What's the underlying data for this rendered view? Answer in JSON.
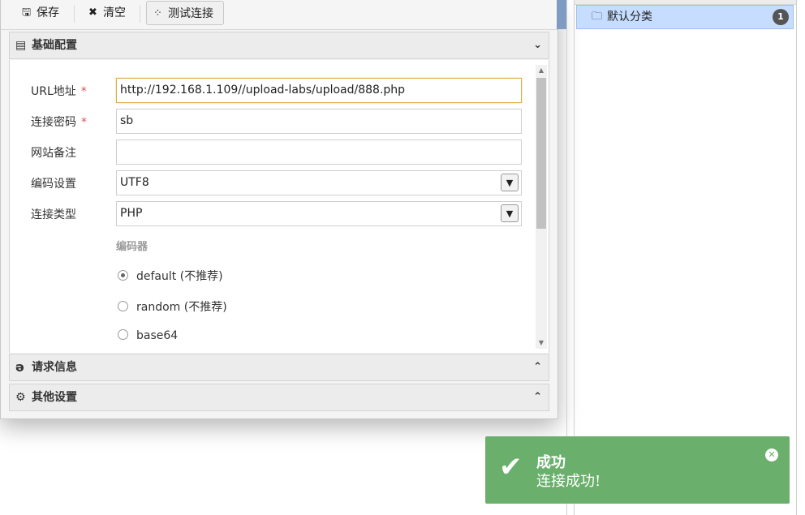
{
  "toolbar": {
    "save_label": "保存",
    "clear_label": "清空",
    "test_label": "测试连接",
    "save_icon": "floppy-icon",
    "clear_icon": "x-icon",
    "test_icon": "spinner-icon"
  },
  "panels": {
    "basic": {
      "title": "基础配置",
      "icon": "file-icon",
      "state": "expanded"
    },
    "request": {
      "title": "请求信息",
      "icon": "e-icon",
      "state": "collapsed"
    },
    "other": {
      "title": "其他设置",
      "icon": "gears-icon",
      "state": "collapsed"
    }
  },
  "form": {
    "url": {
      "label": "URL地址",
      "required_mark": "*",
      "value": "http://192.168.1.109//upload-labs/upload/888.php"
    },
    "password": {
      "label": "连接密码",
      "required_mark": "*",
      "value": "sb"
    },
    "note": {
      "label": "网站备注",
      "value": ""
    },
    "encoding": {
      "label": "编码设置",
      "value": "UTF8"
    },
    "type": {
      "label": "连接类型",
      "value": "PHP"
    },
    "encoder": {
      "title": "编码器",
      "options": [
        {
          "label": "default (不推荐)",
          "checked": true
        },
        {
          "label": "random (不推荐)",
          "checked": false
        },
        {
          "label": "base64",
          "checked": false
        }
      ]
    }
  },
  "categories": [
    {
      "label": "默认分类",
      "count": "1",
      "icon": "folder-icon"
    }
  ],
  "toast": {
    "title": "成功",
    "message": "连接成功!",
    "color": "#6aaf6b"
  },
  "colors": {
    "selected_category_bg": "#c6ddff",
    "required_mark": "#d9534f",
    "focused_border": "#e0ad4e"
  }
}
